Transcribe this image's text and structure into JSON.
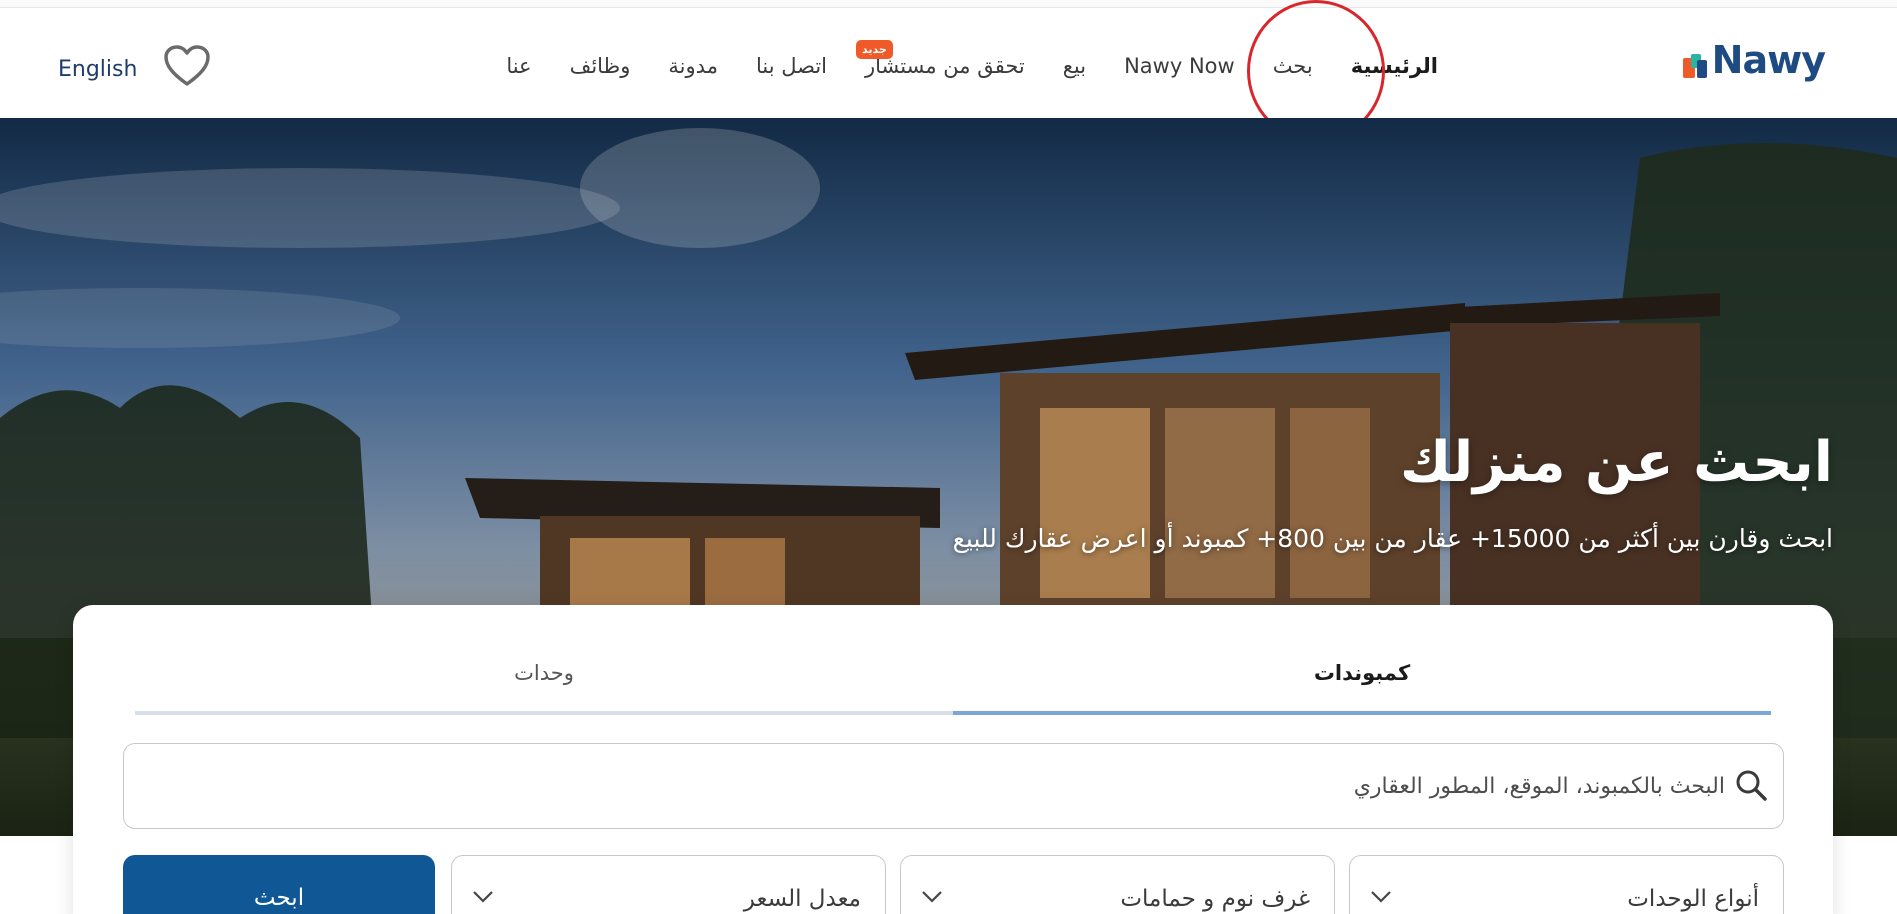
{
  "header": {
    "brand": "Nawy",
    "language_toggle": "English",
    "nav": [
      {
        "label": "الرئيسية"
      },
      {
        "label": "بحث"
      },
      {
        "label": "Nawy Now"
      },
      {
        "label": "بيع"
      },
      {
        "label": "تحقق من مستشار",
        "badge": "جديد"
      },
      {
        "label": "اتصل بنا"
      },
      {
        "label": "مدونة"
      },
      {
        "label": "وظائف"
      },
      {
        "label": "عنا"
      }
    ],
    "icons": {
      "favorites": "heart-icon"
    }
  },
  "hero": {
    "title": "ابحث عن منزلك",
    "subtitle": "ابحث وقارن بين أكثر من 15000+ عقار من بين 800+ كمبوند أو اعرض عقارك للبيع"
  },
  "search_card": {
    "tabs": [
      {
        "label": "كمبوندات",
        "active": true
      },
      {
        "label": "وحدات",
        "active": false
      }
    ],
    "search": {
      "placeholder": "البحث بالكمبوند، الموقع، المطور العقاري",
      "value": ""
    },
    "filters": [
      {
        "label": "أنواع الوحدات"
      },
      {
        "label": "غرف نوم و حمامات"
      },
      {
        "label": "معدل السعر"
      }
    ],
    "submit_label": "ابحث"
  },
  "colors": {
    "brand_blue": "#1e4c82",
    "button_blue": "#0f5795",
    "badge_orange": "#f05a28",
    "active_tab_underline": "#7ba6d6",
    "annotation_red": "#d8262c"
  }
}
